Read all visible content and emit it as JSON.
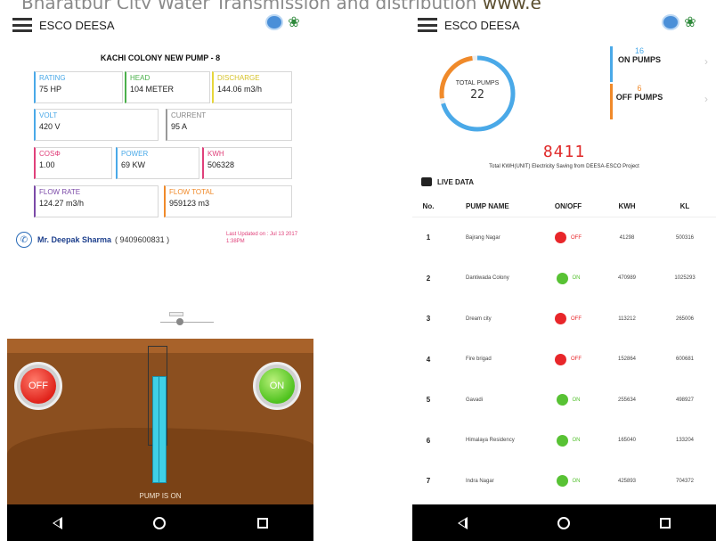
{
  "banner": {
    "text": "Bharatpur City Water Transmission and distribution",
    "link": "www.e"
  },
  "left": {
    "app_title": "ESCO DEESA",
    "pump_title": "KACHI COLONY NEW PUMP - 8",
    "cards": {
      "rating": {
        "label": "RATING",
        "value": "75 HP"
      },
      "head": {
        "label": "HEAD",
        "value": "104 METER"
      },
      "discharge": {
        "label": "DISCHARGE",
        "value": "144.06 m3/h"
      },
      "volt": {
        "label": "VOLT",
        "value": "420 V"
      },
      "current": {
        "label": "CURRENT",
        "value": "95 A"
      },
      "cos": {
        "label": "COSΦ",
        "value": "1.00"
      },
      "power": {
        "label": "POWER",
        "value": "69 KW"
      },
      "kwh": {
        "label": "KWH",
        "value": "506328"
      },
      "flow_rate": {
        "label": "FLOW RATE",
        "value": "124.27 m3/h"
      },
      "flow_total": {
        "label": "FLOW TOTAL",
        "value": "959123 m3"
      }
    },
    "contact_name": "Mr. Deepak Sharma",
    "contact_number": "( 9409600831 )",
    "last_update": "Last Updated on : Jul 13 2017 1:38PM",
    "off_label": "OFF",
    "on_label": "ON",
    "pump_status": "PUMP IS ON"
  },
  "right": {
    "app_title": "ESCO DEESA",
    "total_pumps_label": "TOTAL PUMPS",
    "total_pumps": "22",
    "on_pumps_count": "16",
    "on_pumps_label": "ON PUMPS",
    "off_pumps_count": "6",
    "off_pumps_label": "OFF PUMPS",
    "savings_value": "8411",
    "savings_label": "Total KWH(UNIT) Electricity Saving from DEESA-ESCO Project",
    "live_label": "LIVE DATA",
    "headers": {
      "no": "No.",
      "name": "PUMP NAME",
      "status": "ON/OFF",
      "kwh": "KWH",
      "kl": "KL"
    },
    "rows": [
      {
        "no": "1",
        "name": "Bajrang Nagar",
        "status": "OFF",
        "kwh": "41298",
        "kl": "500316"
      },
      {
        "no": "2",
        "name": "Dantiwada Colony",
        "status": "ON",
        "kwh": "470989",
        "kl": "1025293"
      },
      {
        "no": "3",
        "name": "Dream city",
        "status": "OFF",
        "kwh": "113212",
        "kl": "265006"
      },
      {
        "no": "4",
        "name": "Fire brigad",
        "status": "OFF",
        "kwh": "152864",
        "kl": "600681"
      },
      {
        "no": "5",
        "name": "Gavadi",
        "status": "ON",
        "kwh": "255634",
        "kl": "498927"
      },
      {
        "no": "6",
        "name": "Himalaya Residency",
        "status": "ON",
        "kwh": "165040",
        "kl": "133204"
      },
      {
        "no": "7",
        "name": "Indra Nagar",
        "status": "ON",
        "kwh": "425893",
        "kl": "704372"
      }
    ]
  },
  "colors": {
    "accent_blue": "#4aa9e8",
    "accent_orange": "#f08a2a",
    "on_green": "#58c234",
    "off_red": "#e8262a"
  },
  "icons": [
    "hamburger-icon",
    "phone-icon",
    "back-icon",
    "home-icon",
    "recent-apps-icon",
    "database-icon",
    "chevron-right-icon"
  ]
}
